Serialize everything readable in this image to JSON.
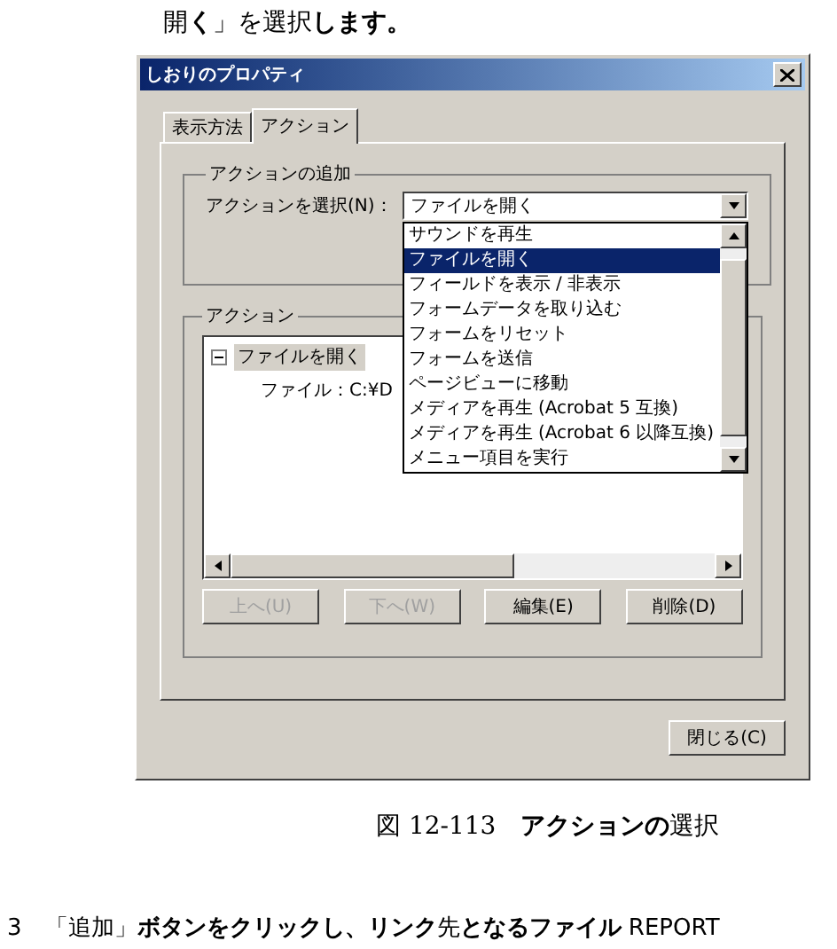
{
  "intro": "開**く**」を選択**します。**",
  "dialog": {
    "title": "しおりのプロパティ",
    "tabs": [
      {
        "label": "表示方法",
        "selected": false
      },
      {
        "label": "アクション",
        "selected": true
      }
    ],
    "add_group": {
      "legend": "アクションの追加",
      "label": "アクションを選択(N)：",
      "value": "ファイルを開く",
      "options": [
        {
          "label": "サウンドを再生",
          "selected": false
        },
        {
          "label": "ファイルを開く",
          "selected": true
        },
        {
          "label": "フィールドを表示 / 非表示",
          "selected": false
        },
        {
          "label": "フォームデータを取り込む",
          "selected": false
        },
        {
          "label": "フォームをリセット",
          "selected": false
        },
        {
          "label": "フォームを送信",
          "selected": false
        },
        {
          "label": "ページビューに移動",
          "selected": false
        },
        {
          "label": "メディアを再生 (Acrobat 5 互換)",
          "selected": false
        },
        {
          "label": "メディアを再生 (Acrobat 6 以降互換)",
          "selected": false
        },
        {
          "label": "メニュー項目を実行",
          "selected": false
        }
      ]
    },
    "action_group": {
      "legend": "アクション",
      "tree": [
        {
          "label": "ファイルを開く",
          "expanded": true,
          "children": [
            {
              "label": "ファイル：C:¥D"
            }
          ]
        }
      ],
      "buttons": [
        {
          "label": "上へ(U)",
          "disabled": true
        },
        {
          "label": "下へ(W)",
          "disabled": true
        },
        {
          "label": "編集(E)",
          "disabled": false
        },
        {
          "label": "削除(D)",
          "disabled": false
        }
      ]
    },
    "close_button": "閉じる(C)"
  },
  "caption": "図 12-113　**アクションの**選択",
  "next_step": "3　「追加」**ボタンをクリックし、リンク**先**となるファイル** REPORT"
}
